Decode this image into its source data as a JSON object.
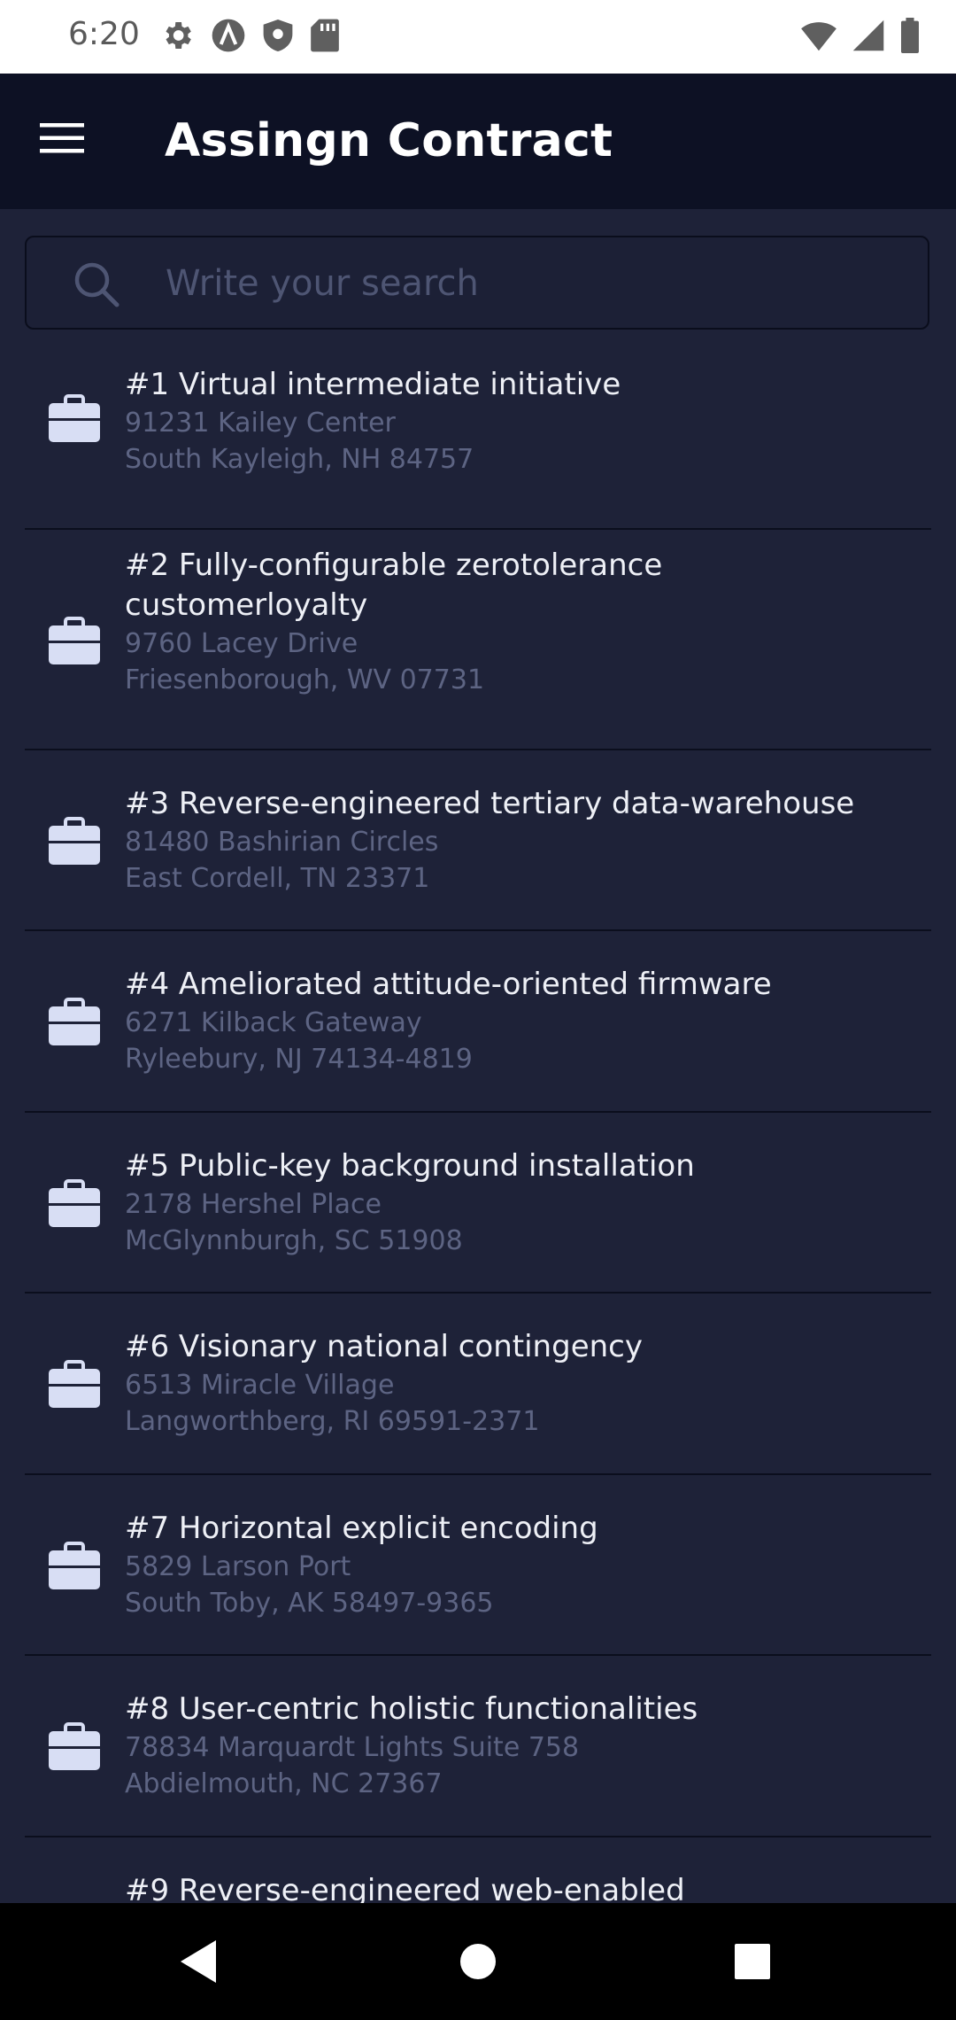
{
  "status_bar": {
    "time": "6:20",
    "icons": [
      "gear-icon",
      "a-circle-icon",
      "shield-icon",
      "sd-card-icon",
      "wifi-icon",
      "signal-icon",
      "battery-icon"
    ]
  },
  "app_bar": {
    "title": "Assingn Contract",
    "menu_icon": "hamburger-menu-icon"
  },
  "search": {
    "placeholder": "Write your search",
    "value": ""
  },
  "colors": {
    "background": "#1e2238",
    "app_bar": "#0d1124",
    "title_text": "#ffffff",
    "secondary_text": "#5d6483",
    "icon": "#d8def4"
  },
  "contracts": [
    {
      "title": "#1 Virtual intermediate initiative",
      "address1": "91231 Kailey Center",
      "address2": "South Kayleigh, NH 84757"
    },
    {
      "title": "#2 Fully-configurable zerotolerance customerloyalty",
      "address1": "9760 Lacey Drive",
      "address2": "Friesenborough, WV 07731"
    },
    {
      "title": "#3 Reverse-engineered tertiary data-warehouse",
      "address1": "81480 Bashirian Circles",
      "address2": "East Cordell, TN 23371"
    },
    {
      "title": "#4 Ameliorated attitude-oriented firmware",
      "address1": "6271 Kilback Gateway",
      "address2": "Ryleebury, NJ 74134-4819"
    },
    {
      "title": "#5 Public-key background installation",
      "address1": "2178 Hershel Place",
      "address2": "McGlynnburgh, SC 51908"
    },
    {
      "title": "#6 Visionary national contingency",
      "address1": "6513 Miracle Village",
      "address2": "Langworthberg, RI 69591-2371"
    },
    {
      "title": "#7 Horizontal explicit encoding",
      "address1": "5829 Larson Port",
      "address2": "South Toby, AK 58497-9365"
    },
    {
      "title": "#8 User-centric holistic functionalities",
      "address1": "78834 Marquardt Lights Suite 758",
      "address2": "Abdielmouth, NC 27367"
    },
    {
      "title": "#9 Reverse-engineered web-enabled",
      "address1": "",
      "address2": ""
    }
  ],
  "nav_bar": {
    "back_icon": "back-triangle-icon",
    "home_icon": "home-circle-icon",
    "recents_icon": "recents-square-icon"
  }
}
